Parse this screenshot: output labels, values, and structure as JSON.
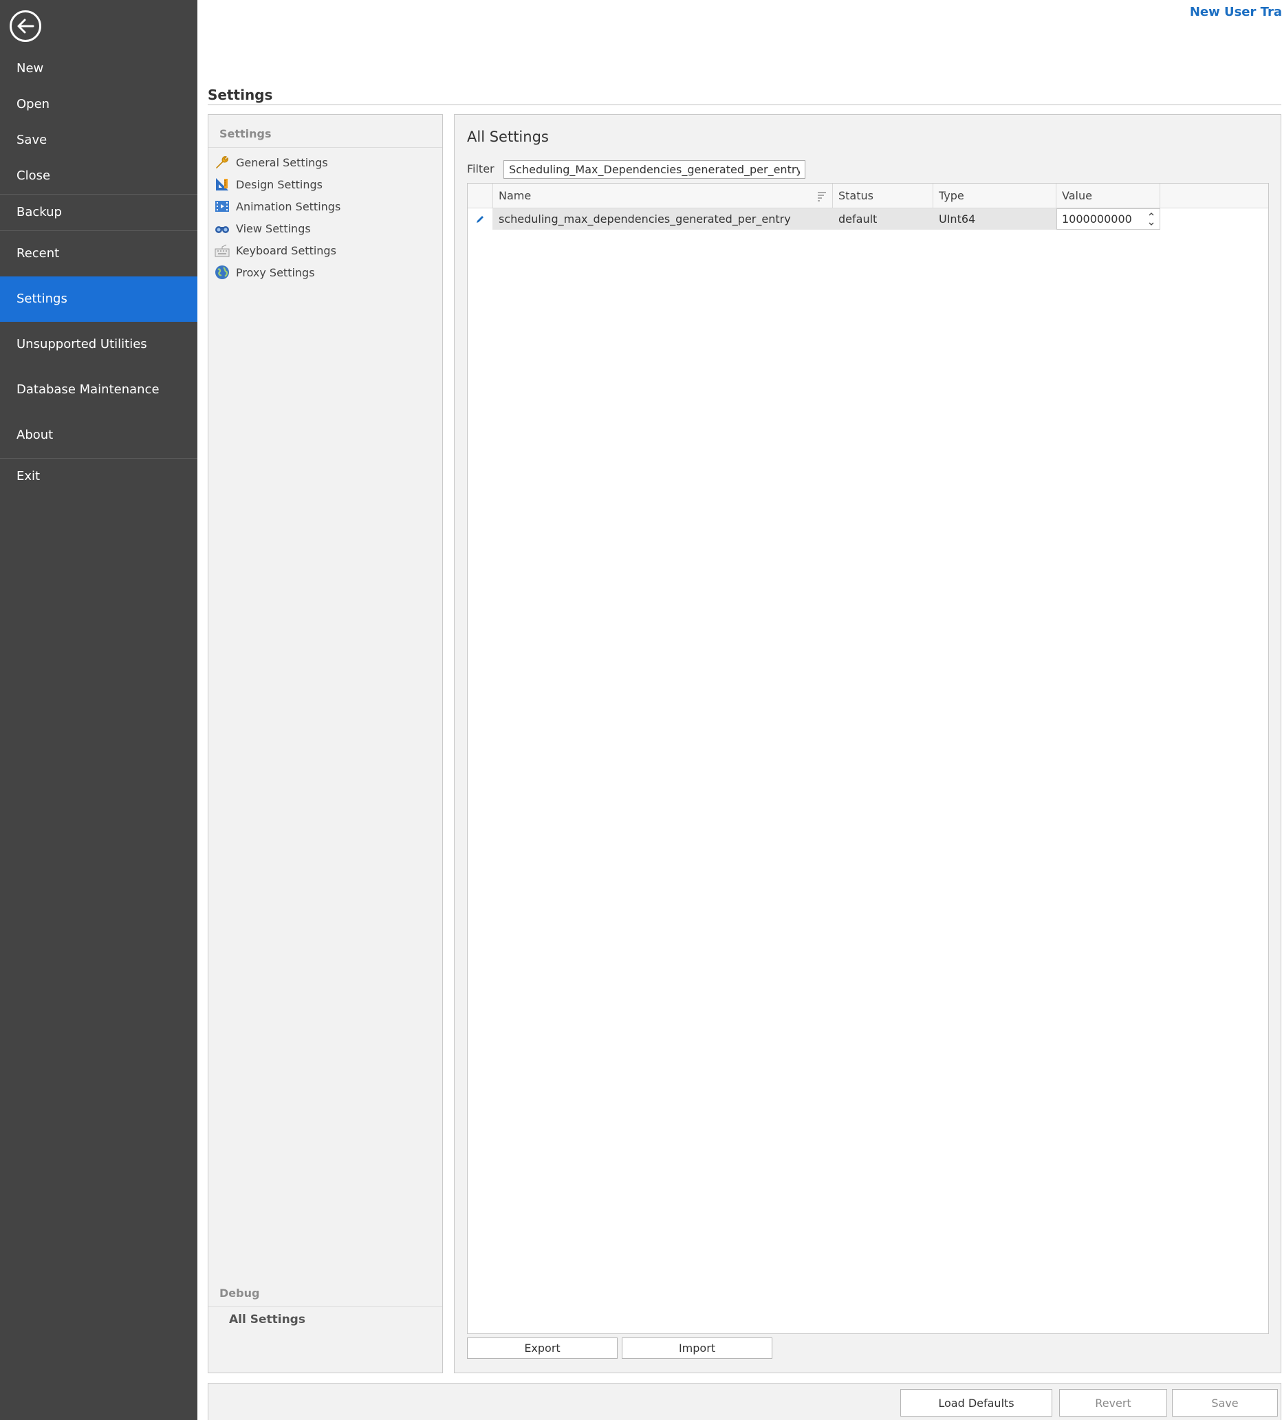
{
  "top_link": "New User Tra",
  "sidebar": {
    "items": [
      {
        "label": "New"
      },
      {
        "label": "Open"
      },
      {
        "label": "Save"
      },
      {
        "label": "Close"
      },
      {
        "label": "Backup"
      },
      {
        "label": "Recent"
      },
      {
        "label": "Settings",
        "active": true
      },
      {
        "label": "Unsupported Utilities"
      },
      {
        "label": "Database Maintenance"
      },
      {
        "label": "About"
      },
      {
        "label": "Exit"
      }
    ]
  },
  "page": {
    "title": "Settings"
  },
  "left_panel": {
    "group_title": "Settings",
    "categories": [
      {
        "label": "General Settings",
        "icon": "wrench-icon"
      },
      {
        "label": "Design Settings",
        "icon": "ruler-triangle-icon"
      },
      {
        "label": "Animation Settings",
        "icon": "film-icon"
      },
      {
        "label": "View Settings",
        "icon": "binoculars-icon"
      },
      {
        "label": "Keyboard Settings",
        "icon": "keyboard-icon"
      },
      {
        "label": "Proxy Settings",
        "icon": "globe-icon"
      }
    ],
    "debug_title": "Debug",
    "debug_items": [
      {
        "label": "All Settings",
        "selected": true
      }
    ]
  },
  "main": {
    "title": "All Settings",
    "filter_label": "Filter",
    "filter_value": "Scheduling_Max_Dependencies_generated_per_entry",
    "columns": [
      "Name",
      "Status",
      "Type",
      "Value"
    ],
    "rows": [
      {
        "name": "scheduling_max_dependencies_generated_per_entry",
        "status": "default",
        "type": "UInt64",
        "value": "1000000000"
      }
    ],
    "export_label": "Export",
    "import_label": "Import"
  },
  "bottom": {
    "load_defaults_label": "Load Defaults",
    "revert_label": "Revert",
    "save_label": "Save"
  }
}
